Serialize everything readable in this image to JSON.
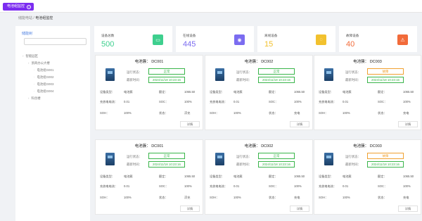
{
  "topbar": {
    "tab_label": "电池组监控"
  },
  "breadcrumb": {
    "home": "储能电站",
    "sep": "/",
    "current": "电池组监控"
  },
  "sidebar": {
    "title": "储能树",
    "tree": [
      {
        "label": "智能园区",
        "level": 0
      },
      {
        "label": "浙商办公大楼",
        "level": 1
      },
      {
        "label": "电池组G001",
        "level": 2
      },
      {
        "label": "电池组G002",
        "level": 2
      },
      {
        "label": "电池组G003",
        "level": 2
      },
      {
        "label": "电池组G004",
        "level": 2
      },
      {
        "label": "科创楼",
        "level": 1
      }
    ]
  },
  "stats": [
    {
      "label": "设备总数",
      "value": "500",
      "color": "#3ecf8e",
      "icon": "device-icon"
    },
    {
      "label": "在线设备",
      "value": "445",
      "color": "#7b6cf0",
      "icon": "wifi-icon"
    },
    {
      "label": "离线设备",
      "value": "15",
      "color": "#f2c12e",
      "icon": "wifi-off-icon"
    },
    {
      "label": "故障设备",
      "value": "40",
      "color": "#f26b3a",
      "icon": "warning-icon"
    }
  ],
  "card_labels": {
    "title_prefix": "电池簇：",
    "run_state": "运行状态：",
    "update_time": "最新时间：",
    "device_type": "设备类型：",
    "rated": "额定：",
    "charge": "充放电电流：",
    "soc": "SOC：",
    "soh": "SOH：",
    "status": "状态：",
    "detail": "详情"
  },
  "cards": [
    {
      "id": "DC001",
      "state": "正常",
      "warn": false,
      "time": "2024/11/18 10:23:16",
      "type": "电池簇",
      "rated": "1065.50",
      "current": "0.01",
      "soc": "100%",
      "soh": "100%",
      "status": "浮充"
    },
    {
      "id": "DC002",
      "state": "正常",
      "warn": false,
      "time": "2024/11/18 10:23:16",
      "type": "电池簇",
      "rated": "1065.50",
      "current": "0.01",
      "soc": "100%",
      "soh": "100%",
      "status": "充电"
    },
    {
      "id": "DC003",
      "state": "故障",
      "warn": true,
      "time": "2024/11/18 10:23:16",
      "type": "电池簇",
      "rated": "1065.50",
      "current": "0.01",
      "soc": "100%",
      "soh": "100%",
      "status": "充电"
    },
    {
      "id": "DC001",
      "state": "正常",
      "warn": false,
      "time": "2024/11/18 10:23:16",
      "type": "电池簇",
      "rated": "1065.50",
      "current": "0.01",
      "soc": "100%",
      "soh": "100%",
      "status": "浮充"
    },
    {
      "id": "DC002",
      "state": "正常",
      "warn": false,
      "time": "2024/11/18 10:23:16",
      "type": "电池簇",
      "rated": "1065.50",
      "current": "0.01",
      "soc": "100%",
      "soh": "100%",
      "status": "充电"
    },
    {
      "id": "DC003",
      "state": "故障",
      "warn": true,
      "time": "2024/11/18 10:23:16",
      "type": "电池簇",
      "rated": "1065.50",
      "current": "0.01",
      "soc": "100%",
      "soh": "100%",
      "status": "充电"
    }
  ]
}
